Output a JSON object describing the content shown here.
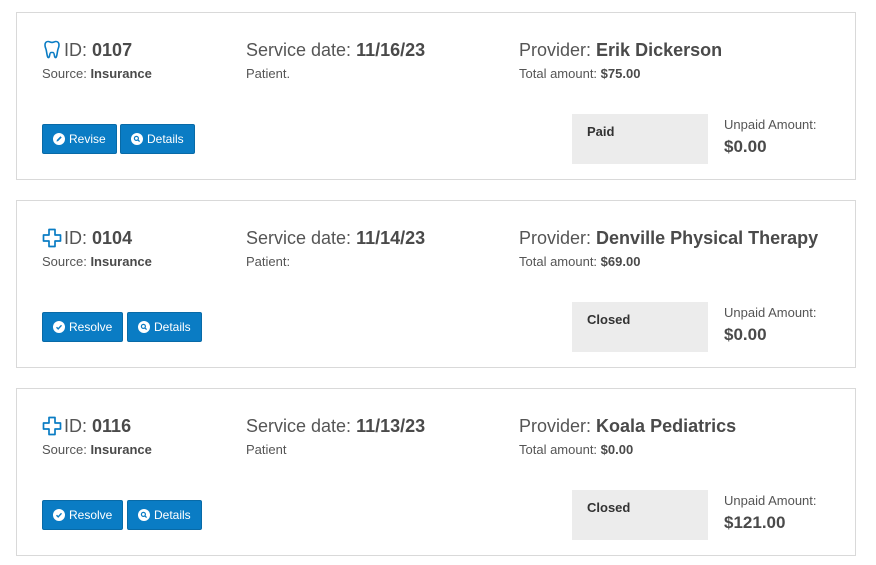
{
  "claims": [
    {
      "icon": "tooth-icon",
      "id_label": "ID:",
      "id": "0107",
      "source_label": "Source:",
      "source": "Insurance",
      "service_date_label": "Service date:",
      "service_date": "11/16/23",
      "patient_label": "Patient.",
      "provider_label": "Provider:",
      "provider": "Erik Dickerson",
      "total_label": "Total amount:",
      "total": "$75.00",
      "action_label": "Revise",
      "action_icon": "pencil-circle-icon",
      "details_label": "Details",
      "status": "Paid",
      "unpaid_label": "Unpaid Amount:",
      "unpaid": "$0.00"
    },
    {
      "icon": "medical-cross-icon",
      "id_label": "ID:",
      "id": "0104",
      "source_label": "Source:",
      "source": "Insurance",
      "service_date_label": "Service date:",
      "service_date": "11/14/23",
      "patient_label": "Patient:",
      "provider_label": "Provider:",
      "provider": "Denville Physical Therapy",
      "total_label": "Total amount:",
      "total": "$69.00",
      "action_label": "Resolve",
      "action_icon": "check-circle-icon",
      "details_label": "Details",
      "status": "Closed",
      "unpaid_label": "Unpaid Amount:",
      "unpaid": "$0.00"
    },
    {
      "icon": "medical-cross-icon",
      "id_label": "ID:",
      "id": "0116",
      "source_label": "Source:",
      "source": "Insurance",
      "service_date_label": "Service date:",
      "service_date": "11/13/23",
      "patient_label": "Patient",
      "provider_label": "Provider:",
      "provider": "Koala Pediatrics",
      "total_label": "Total amount:",
      "total": "$0.00",
      "action_label": "Resolve",
      "action_icon": "check-circle-icon",
      "details_label": "Details",
      "status": "Closed",
      "unpaid_label": "Unpaid Amount:",
      "unpaid": "$121.00"
    }
  ],
  "colors": {
    "button": "#0a7cc4",
    "status_bg": "#ececec",
    "icon": "#0a7cc4",
    "border": "#d9d9d9"
  }
}
